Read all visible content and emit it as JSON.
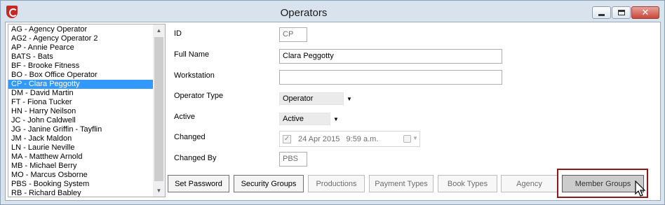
{
  "window": {
    "title": "Operators",
    "close_glyph": "✕"
  },
  "operators": [
    "AG - Agency Operator",
    "AG2 - Agency Operator 2",
    "AP - Annie Pearce",
    "BATS - Bats",
    "BF - Brooke Fitness",
    "BO - Box Office Operator",
    "CP - Clara Peggotty",
    "DM - David Martin",
    "FT - Fiona Tucker",
    "HN - Harry Neilson",
    "JC - John Caldwell",
    "JG - Janine Griffin - Tayflin",
    "JM - Jack Maldon",
    "LN - Laurie Neville",
    "MA - Matthew Arnold",
    "MB - Michael Berry",
    "MO - Marcus Osborne",
    "PBS - Booking System",
    "RB - Richard Babley"
  ],
  "selected_operator": "CP - Clara Peggotty",
  "scroll": {
    "up_glyph": "▲",
    "down_glyph": "▼"
  },
  "form": {
    "id": {
      "label": "ID",
      "value": "CP"
    },
    "full_name": {
      "label": "Full Name",
      "value": "Clara Peggotty"
    },
    "workstation": {
      "label": "Workstation",
      "value": ""
    },
    "operator_type": {
      "label": "Operator Type",
      "value": "Operator"
    },
    "active": {
      "label": "Active",
      "value": "Active"
    },
    "changed": {
      "label": "Changed",
      "checked_glyph": "✓",
      "date": "24 Apr 2015",
      "time": "9:59 a.m."
    },
    "changed_by": {
      "label": "Changed By",
      "value": "PBS"
    },
    "dropdown_glyph": "▼"
  },
  "buttons": {
    "set_password": "Set Password",
    "security_groups": "Security Groups",
    "productions": "Productions",
    "payment_types": "Payment Types",
    "book_types": "Book Types",
    "agency": "Agency",
    "member_groups": "Member Groups"
  },
  "colors": {
    "selection": "#3399ff",
    "highlight_border": "#8b1a1a",
    "close_button": "#c9473a"
  }
}
